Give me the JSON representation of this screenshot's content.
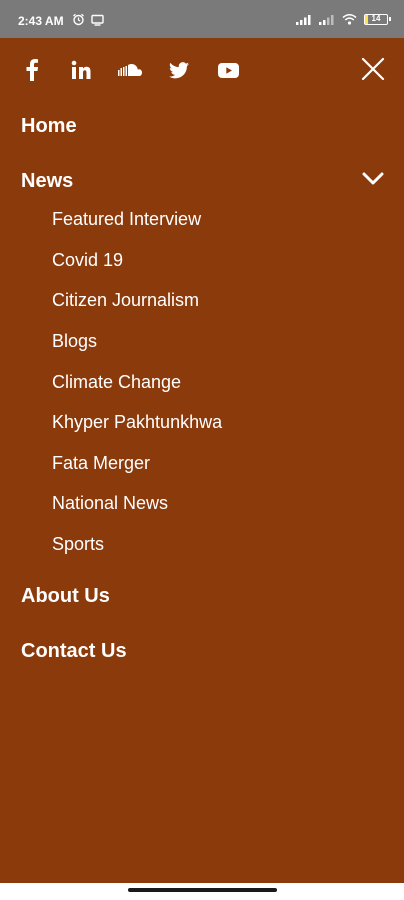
{
  "status_bar": {
    "time": "2:43 AM",
    "battery": "14"
  },
  "social": [
    "facebook-icon",
    "linkedin-icon",
    "soundcloud-icon",
    "twitter-icon",
    "youtube-icon"
  ],
  "menu": {
    "home": "Home",
    "news": "News",
    "news_items": [
      "Featured Interview",
      "Covid 19",
      "Citizen Journalism",
      "Blogs",
      "Climate Change",
      "Khyper Pakhtunkhwa",
      "Fata Merger",
      "National News",
      "Sports"
    ],
    "about": "About Us",
    "contact": "Contact Us"
  },
  "colors": {
    "drawer_background": "#8b3a0c",
    "status_bar": "#7a7a7a",
    "text": "#ffffff"
  }
}
